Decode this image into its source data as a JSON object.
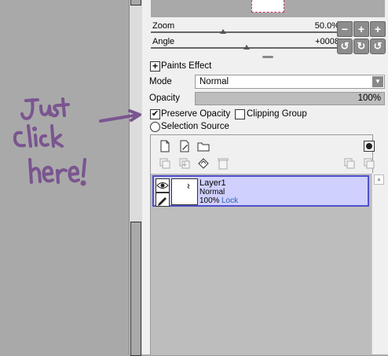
{
  "navigator": {
    "zoom_label": "Zoom",
    "zoom_value": "50.0%",
    "zoom_level": 0.5,
    "angle_label": "Angle",
    "angle_value": "+0008",
    "angle_level": 0.47
  },
  "nav_buttons": [
    "zoom-out",
    "zoom-in",
    "zoom-reset",
    "rotate-left",
    "rotate-right",
    "rotate-reset"
  ],
  "paints_effect": {
    "label": "Paints Effect"
  },
  "mode": {
    "label": "Mode",
    "value": "Normal"
  },
  "opacity": {
    "label": "Opacity",
    "value": "100%"
  },
  "options": {
    "preserve_opacity": {
      "label": "Preserve Opacity",
      "checked": true
    },
    "clipping_group": {
      "label": "Clipping Group",
      "checked": false
    },
    "selection_source": {
      "label": "Selection Source",
      "selected": false
    }
  },
  "layer_tools": [
    "new-layer-icon",
    "new-linework-layer-icon",
    "new-folder-icon",
    "new-mask-icon"
  ],
  "layer_ops": [
    "transfer-down-icon",
    "merge-down-icon",
    "clear-layer-icon",
    "delete-layer-icon",
    "apply-mask-icon",
    "link-mask-icon"
  ],
  "layers": [
    {
      "name": "Layer1",
      "mode": "Normal",
      "opacity": "100%",
      "lock": "Lock",
      "visible": true,
      "selected": true
    }
  ],
  "annotation": {
    "text_lines": [
      "Just",
      "click",
      "here!"
    ],
    "color": "#7a5590"
  },
  "colors": {
    "selection": "#d0d0ff",
    "selection_border": "#5050c8",
    "panel_bg": "#f0f0f0",
    "canvas_bg": "#a9a9a9"
  }
}
